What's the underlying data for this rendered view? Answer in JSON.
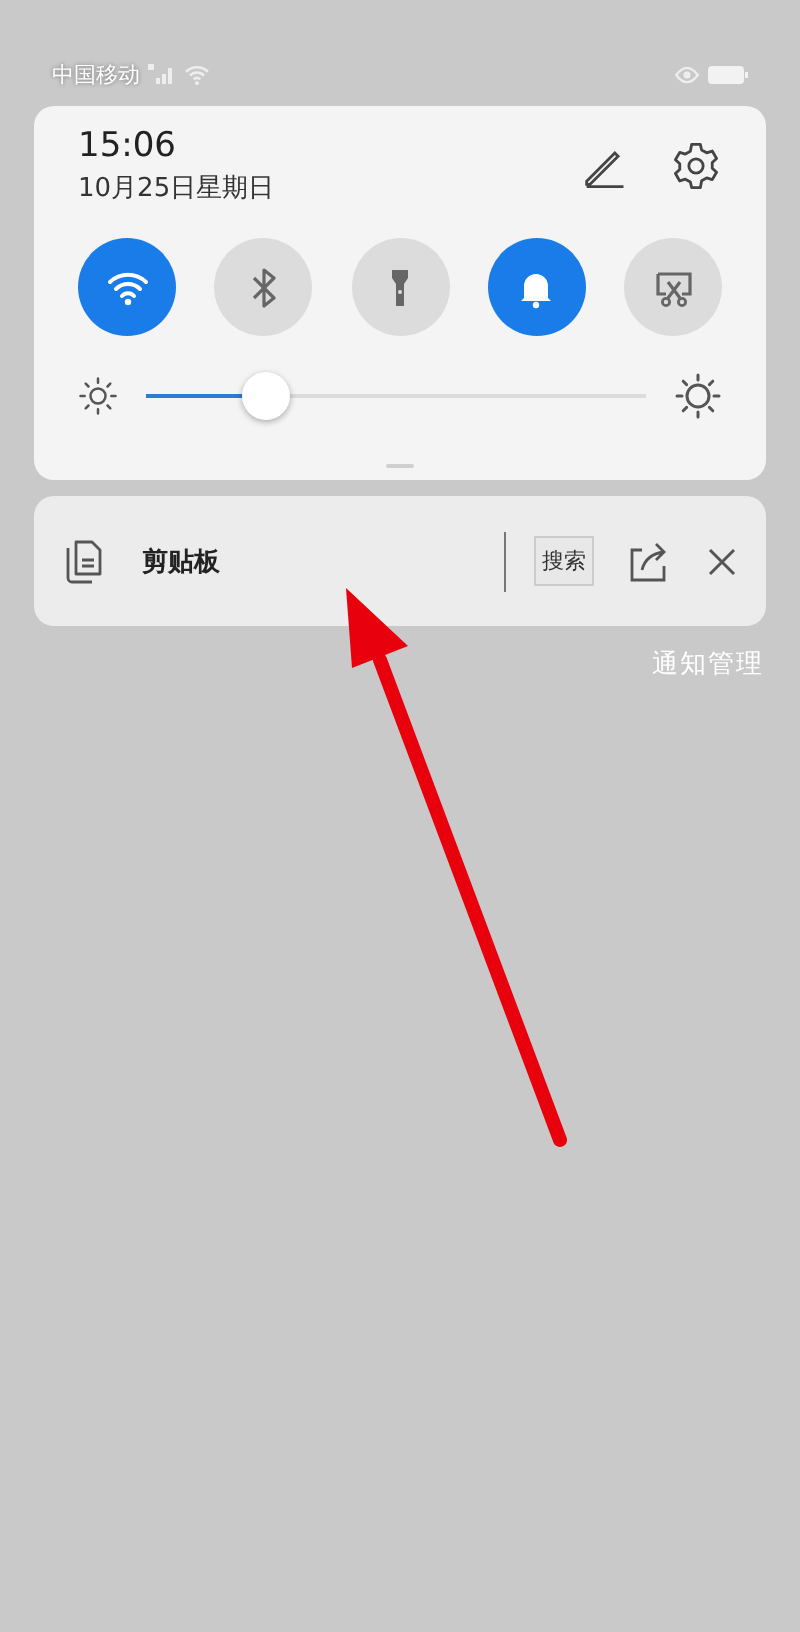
{
  "status_bar": {
    "carrier": "中国移动"
  },
  "quick_panel": {
    "time": "15:06",
    "date": "10月25日星期日",
    "toggles": [
      {
        "kind": "wifi",
        "on": true
      },
      {
        "kind": "bluetooth",
        "on": false
      },
      {
        "kind": "flashlight",
        "on": false
      },
      {
        "kind": "bell",
        "on": true
      },
      {
        "kind": "screenshot",
        "on": false
      }
    ],
    "brightness": {
      "level": 0.24
    }
  },
  "notification": {
    "title": "剪贴板",
    "search_button": "搜索"
  },
  "manage_link": "通知管理"
}
